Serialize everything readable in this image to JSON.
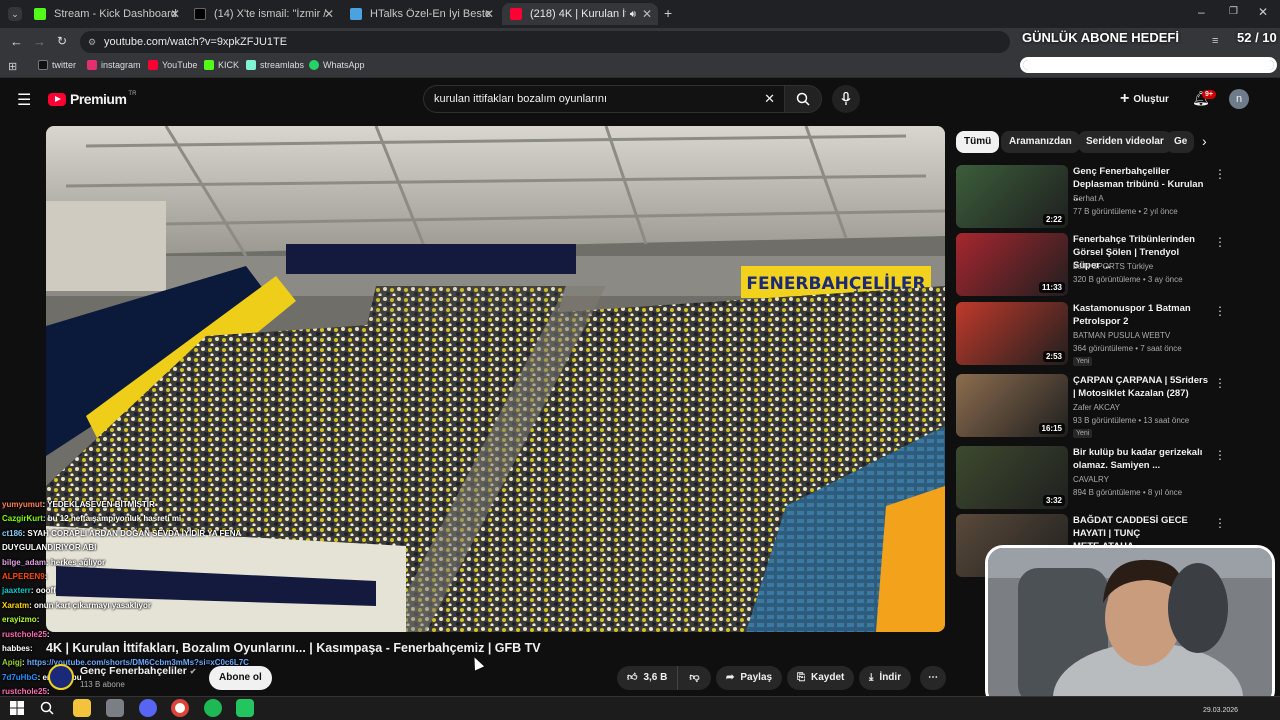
{
  "browser": {
    "tabs": [
      {
        "title": "Stream - Kick Dashboard",
        "fav_color": "#53fc18"
      },
      {
        "title": "(14) X'te ismail: \"İzmir / Bakırçe",
        "fav_color": "#000000"
      },
      {
        "title": "HTalks Özel-En İyi Beste Kimde",
        "fav_color": "#4aa3df"
      },
      {
        "title": "(218) 4K | Kurulan İttifakları",
        "fav_color": "#ff0033"
      }
    ],
    "url": "youtube.com/watch?v=9xpkZFJU1TE",
    "bookmarks": [
      {
        "label": "twitter",
        "color": "#111111"
      },
      {
        "label": "instagram",
        "color": "#e1306c"
      },
      {
        "label": "YouTube",
        "color": "#ff0033"
      },
      {
        "label": "KICK",
        "color": "#53fc18"
      },
      {
        "label": "streamlabs",
        "color": "#80f5d2"
      },
      {
        "label": "WhatsApp",
        "color": "#25d366"
      }
    ]
  },
  "overlay": {
    "goal_title": "GÜNLÜK ABONE HEDEFİ",
    "goal_count": "52 / 10",
    "goal_progress": 1.0
  },
  "youtube": {
    "logo": "Premium",
    "logo_sup": "TR",
    "search_value": "kurulan ittifakları bozalım oyunlarını",
    "create_label": "Oluştur",
    "notif_badge": "9+",
    "avatar_letter": "n",
    "chips": [
      "Tümü",
      "Aramanızdan",
      "Seriden videolar",
      "Ge"
    ]
  },
  "video": {
    "title": "4K | Kurulan İttifakları, Bozalım Oyunlarını... | Kasımpaşa - Fenerbahçemiz | GFB TV",
    "channel": "Genç Fenerbahçeliler",
    "subscribers": "113 B abone",
    "subscribe_label": "Abone ol",
    "likes": "3,6 B",
    "share_label": "Paylaş",
    "save_label": "Kaydet",
    "download_label": "İndir",
    "banner_text": "FENERBAHÇELİLER"
  },
  "recommendations": [
    {
      "title": "Genç Fenerbahçeliler Deplasman tribünü - Kurulan ...",
      "channel": "Serhat A",
      "meta": "77 B görüntüleme • 2 yıl önce",
      "duration": "2:22",
      "new": "",
      "thumb": "#3b5e3a"
    },
    {
      "title": "Fenerbahçe Tribünlerinden Görsel Şölen | Trendyol Süper ...",
      "channel": "beIN SPORTS Türkiye",
      "meta": "320 B görüntüleme • 3 ay önce",
      "duration": "11:33",
      "new": "",
      "thumb": "#a8262f"
    },
    {
      "title": "Kastamonuspor 1 Batman Petrolspor 2",
      "channel": "BATMAN PUSULA WEBTV",
      "meta": "364 görüntüleme • 7 saat önce",
      "duration": "2:53",
      "new": "Yeni",
      "thumb": "#c0392b"
    },
    {
      "title": "ÇARPAN ÇARPANA | 5Sriders | Motosiklet Kazalan (287)",
      "channel": "Zafer AKCAY",
      "meta": "93 B görüntüleme • 13 saat önce",
      "duration": "16:15",
      "new": "Yeni",
      "thumb": "#8c6d4f"
    },
    {
      "title": "Bir kulüp bu kadar gerizekalı olamaz. Samiyen ...",
      "channel": "CAVALRY",
      "meta": "894 B görüntüleme • 8 yıl önce",
      "duration": "3:32",
      "new": "",
      "thumb": "#3d4a2e"
    },
    {
      "title": "BAĞDAT CADDESİ GECE HAYATI | TUNÇ METE,ATAHA...",
      "channel": "",
      "meta": "",
      "duration": "",
      "new": "",
      "thumb": "#5a4a3a"
    }
  ],
  "chat": [
    {
      "user": "yumyumut",
      "color": "#ff7f50",
      "msg": "YEDEKLASEVEN BİTMİŞTİR"
    },
    {
      "user": "CazgirKurt",
      "color": "#7fff00",
      "msg": "bu 12 hefta şampiyonluk hasreti mi"
    },
    {
      "user": "ct186",
      "color": "#87cefa",
      "msg": "SYAH CORAPLI ARDAN DOĞAN SEVDA İYİDİR YA FENA"
    },
    {
      "user": "",
      "color": "#ffffff",
      "msg": "DUYGULANDIRIYOR ABI"
    },
    {
      "user": "bilge_adam",
      "color": "#dda0dd",
      "msg": "herkes ağlıyor"
    },
    {
      "user": "ALPEREN9",
      "color": "#ff4500",
      "msg": ""
    },
    {
      "user": "jaaxterr",
      "color": "#00ced1",
      "msg": "oooff"
    },
    {
      "user": "Xaratm",
      "color": "#ffd700",
      "msg": "onun kart çıkarmayı yasaklıyor"
    },
    {
      "user": "erayizmo",
      "color": "#adff2f",
      "msg": ""
    },
    {
      "user": "rustchole25",
      "color": "#ff69b4",
      "msg": ""
    },
    {
      "user": "habbes",
      "color": "#ffffff",
      "msg": ""
    },
    {
      "user": "Apigj",
      "color": "#9acd32",
      "msg": "https://youtube.com/shorts/DM6Ccbm3mMs?si=xC0c6L7C"
    },
    {
      "user": "7d7uHbG",
      "color": "#1e90ff",
      "msg": "en iyisi bu"
    },
    {
      "user": "rustchole25",
      "color": "#ff69b4",
      "msg": ""
    }
  ],
  "taskbar": {
    "date": "29.03.2026"
  }
}
